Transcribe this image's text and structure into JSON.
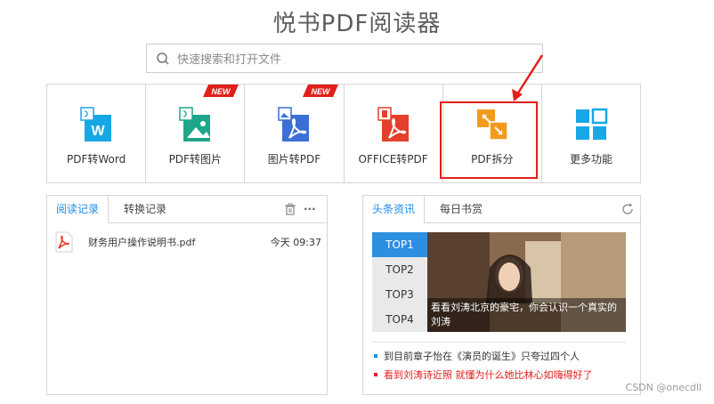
{
  "app": {
    "title": "悦书PDF阅读器"
  },
  "search": {
    "placeholder": "快速搜索和打开文件",
    "icon": "search-icon"
  },
  "tools": [
    {
      "label": "PDF转Word",
      "icon": "pdf-to-word-icon",
      "new": false
    },
    {
      "label": "PDF转图片",
      "icon": "pdf-to-image-icon",
      "new": true
    },
    {
      "label": "图片转PDF",
      "icon": "image-to-pdf-icon",
      "new": true
    },
    {
      "label": "OFFICE转PDF",
      "icon": "office-to-pdf-icon",
      "new": false
    },
    {
      "label": "PDF拆分",
      "icon": "pdf-split-icon",
      "new": false,
      "highlighted": true
    },
    {
      "label": "更多功能",
      "icon": "more-features-icon",
      "new": false
    }
  ],
  "new_badge": "NEW",
  "left_panel": {
    "tabs": [
      "阅读记录",
      "转换记录"
    ],
    "active_tab": "阅读记录",
    "more": "···",
    "files": [
      {
        "name": "财务用户操作说明书.pdf",
        "time": "今天 09:37"
      }
    ]
  },
  "right_panel": {
    "tabs": [
      "头条资讯",
      "每日书赏"
    ],
    "active_tab": "头条资讯",
    "top_items": [
      "TOP1",
      "TOP2",
      "TOP3",
      "TOP4"
    ],
    "active_top": "TOP1",
    "caption": "看看刘涛北京的豪宅，你会认识一个真实的刘涛",
    "links": [
      {
        "text": "到目前章子怡在《演员的诞生》只夸过四个人",
        "color": "#333333"
      },
      {
        "text": "看到刘涛诗近照 就懂为什么她比林心如嗨得好了",
        "color": "#e0201b"
      }
    ]
  },
  "colors": {
    "accent": "#1f8ce6",
    "highlight": "#e0201b",
    "new_badge": "#e0201b"
  },
  "watermark": "CSDN @onecdll"
}
